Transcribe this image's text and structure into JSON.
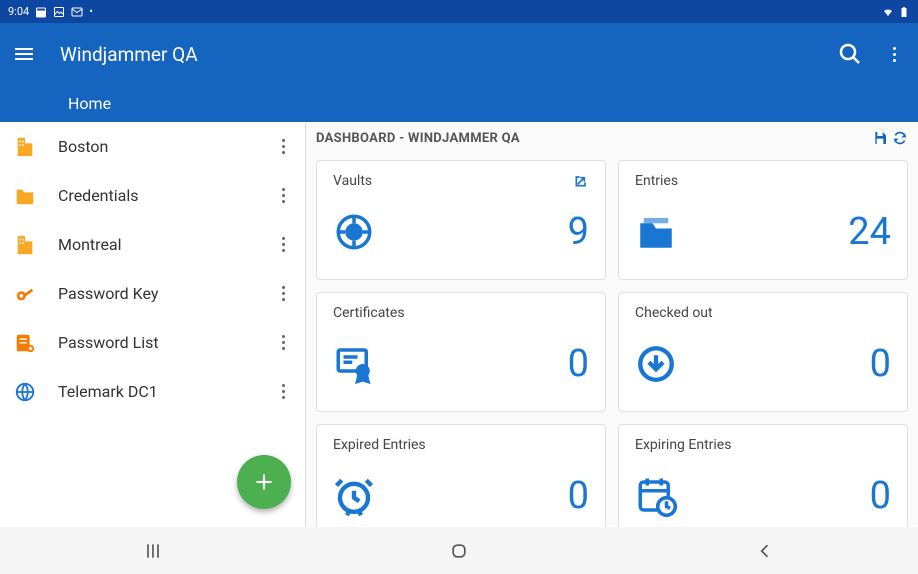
{
  "status": {
    "time": "9:04",
    "dot": "•"
  },
  "app": {
    "title": "Windjammer QA"
  },
  "tabs": {
    "home": "Home"
  },
  "sidebar": {
    "items": [
      {
        "label": "Boston",
        "icon": "building"
      },
      {
        "label": "Credentials",
        "icon": "folder"
      },
      {
        "label": "Montreal",
        "icon": "building"
      },
      {
        "label": "Password Key",
        "icon": "key"
      },
      {
        "label": "Password List",
        "icon": "list"
      },
      {
        "label": "Telemark DC1",
        "icon": "globe"
      }
    ]
  },
  "dashboard": {
    "title": "DASHBOARD - WINDJAMMER QA",
    "cards": [
      {
        "label": "Vaults",
        "value": "9",
        "hasAction": true
      },
      {
        "label": "Entries",
        "value": "24"
      },
      {
        "label": "Certificates",
        "value": "0"
      },
      {
        "label": "Checked out",
        "value": "0"
      },
      {
        "label": "Expired Entries",
        "value": "0"
      },
      {
        "label": "Expiring Entries",
        "value": "0"
      }
    ]
  }
}
